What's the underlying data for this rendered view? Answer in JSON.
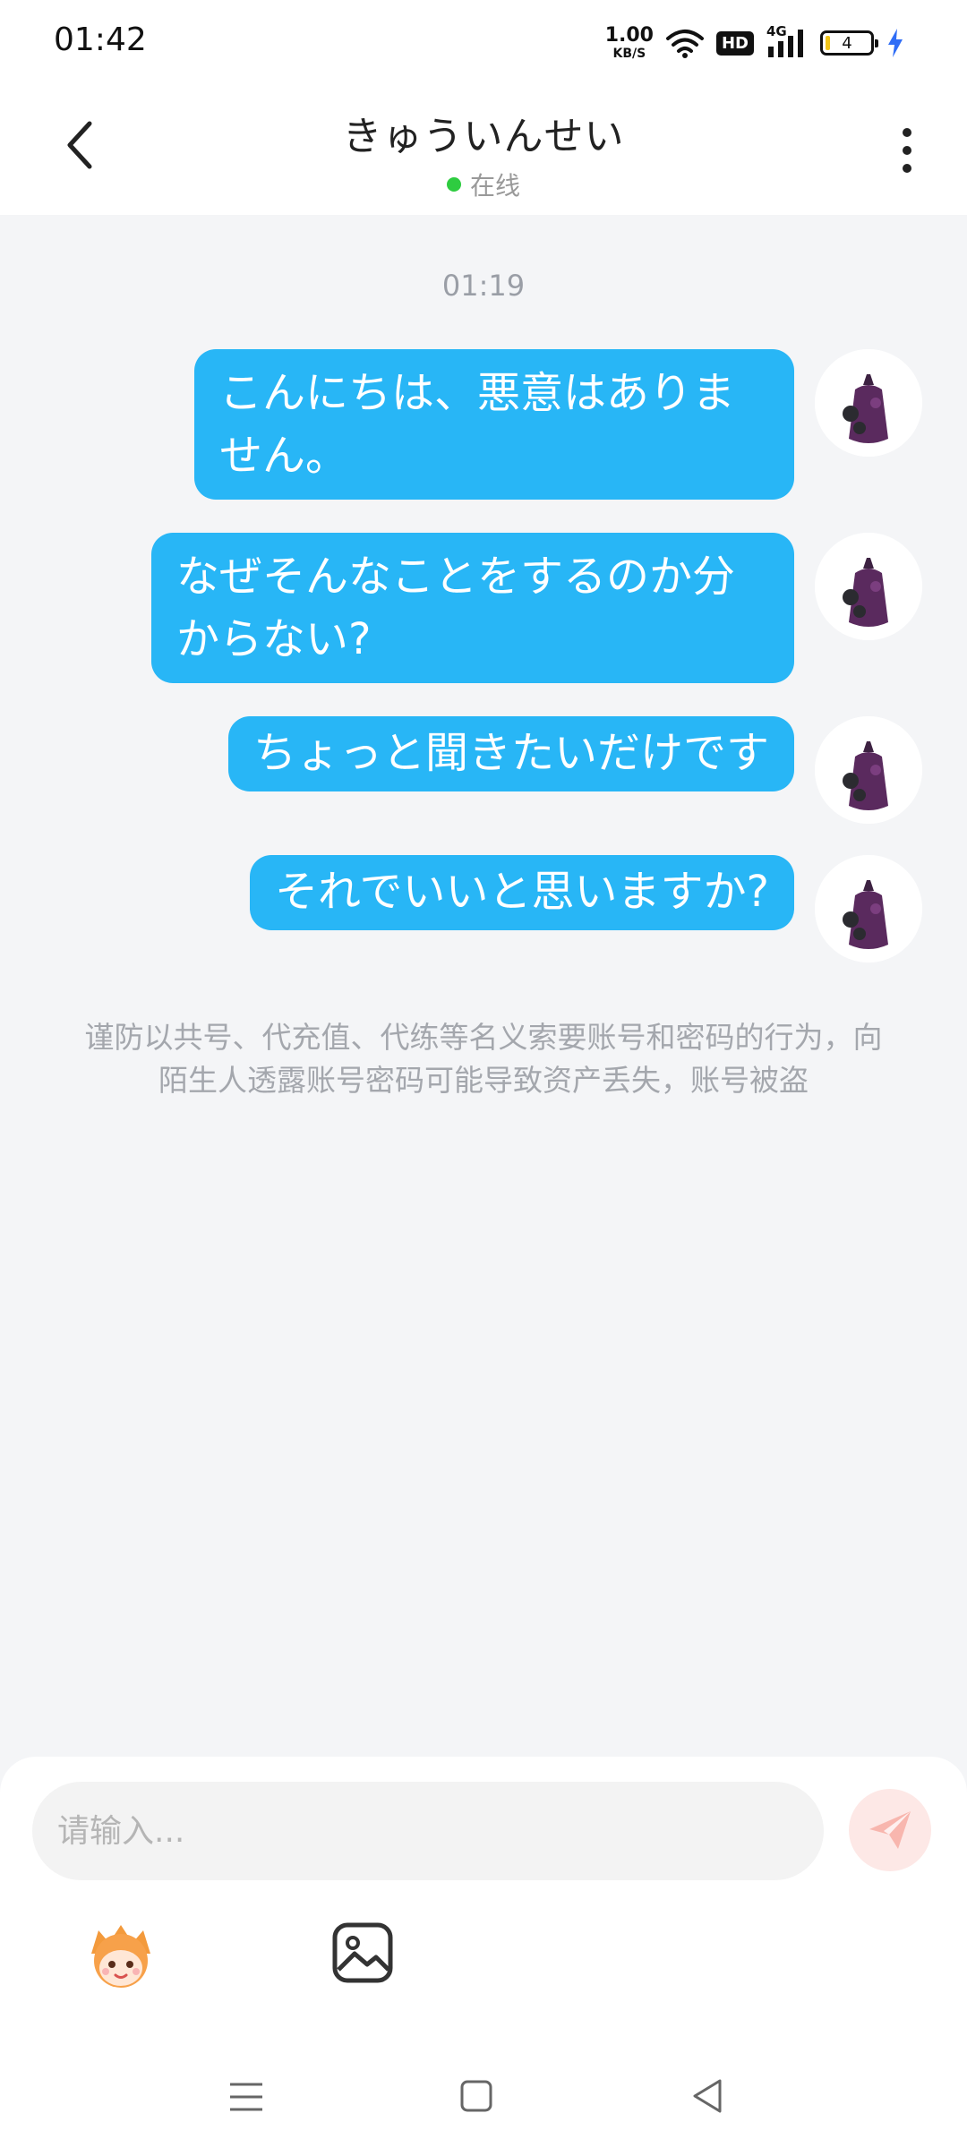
{
  "status_bar": {
    "time": "01:42",
    "net_speed_value": "1.00",
    "net_speed_unit": "KB/S",
    "hd_label": "HD",
    "network_label": "4G",
    "battery_level": "4"
  },
  "header": {
    "title": "きゅういんせい",
    "status": "在线"
  },
  "chat": {
    "timestamp": "01:19",
    "messages": [
      {
        "text": "こんにちは、悪意はありません。"
      },
      {
        "text": "なぜそんなことをするのか分からない?"
      },
      {
        "text": "ちょっと聞きたいだけです"
      },
      {
        "text": "それでいいと思いますか?"
      }
    ],
    "notice": "谨防以共号、代充值、代练等名义索要账号和密码的行为，向陌生人透露账号密码可能导致资产丢失，账号被盗"
  },
  "composer": {
    "placeholder": "请输入...",
    "send_icon": "send-icon",
    "emoji_icon": "emoji-sticker-icon",
    "image_icon": "image-icon"
  },
  "colors": {
    "bubble": "#28b6f6",
    "online_dot": "#2ecc40",
    "background": "#f4f5f7"
  }
}
